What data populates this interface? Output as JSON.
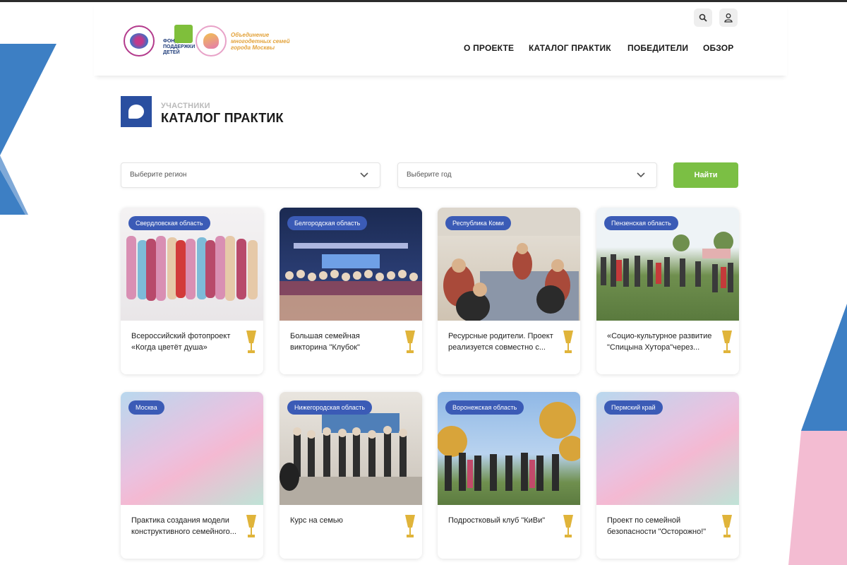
{
  "header": {
    "logos": {
      "fund_text": "ФОНД ПОДДЕРЖКИ ДЕТЕЙ",
      "ms_text": "Объединение многодетных семей города Москвы"
    },
    "nav": [
      {
        "label": "О ПРОЕКТЕ"
      },
      {
        "label": "КАТАЛОГ ПРАКТИК"
      },
      {
        "label": "ПОБЕДИТЕЛИ"
      },
      {
        "label": "ОБЗОР"
      }
    ],
    "icons": {
      "search": "search-icon",
      "user": "user-icon"
    }
  },
  "page": {
    "subtitle": "УЧАСТНИКИ",
    "title": "КАТАЛОГ ПРАКТИК"
  },
  "filters": {
    "region_placeholder": "Выберите регион",
    "year_placeholder": "Выберите год",
    "find_label": "Найти"
  },
  "cards": [
    {
      "region": "Свердловская область",
      "title": "Всероссийский фотопроект «Когда цветёт душа»"
    },
    {
      "region": "Белгородская область",
      "title": "Большая семейная викторина \"Клубок\""
    },
    {
      "region": "Республика Коми",
      "title": "Ресурсные родители. Проект реализуется совместно с..."
    },
    {
      "region": "Пензенская область",
      "title": "«Социо-культурное развитие \"Спицына Хутора\"через..."
    },
    {
      "region": "Москва",
      "title": "Практика создания модели конструктивного семейного..."
    },
    {
      "region": "Нижегородская область",
      "title": "Курс на семью"
    },
    {
      "region": "Воронежская область",
      "title": "Подростковый клуб \"КиВи\""
    },
    {
      "region": "Пермский край",
      "title": "Проект по семейной безопасности \"Осторожно!\""
    }
  ],
  "colors": {
    "brand_blue": "#3b5bb6",
    "accent_green": "#7bbf44",
    "deco_blue": "#3d7fc4",
    "deco_pink": "#f3bcd2",
    "cup_gold": "#e0b43a"
  }
}
